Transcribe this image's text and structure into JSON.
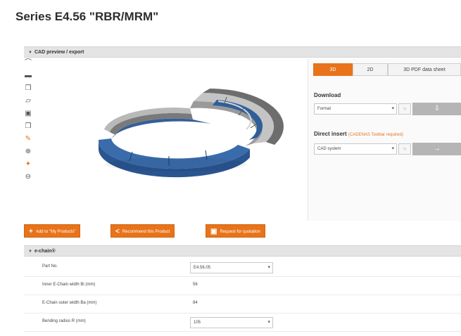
{
  "page_title": "Series E4.56 \"RBR/MRM\"",
  "cad_section": {
    "label": "CAD preview / export",
    "tools": [
      {
        "icon": "view-front-icon",
        "glyph": "⌒"
      },
      {
        "icon": "view-top-icon",
        "glyph": "▬"
      },
      {
        "icon": "view-side-icon",
        "glyph": "❒"
      },
      {
        "icon": "view-iso-icon",
        "glyph": "▱"
      },
      {
        "icon": "view-bottom-icon",
        "glyph": "▣"
      },
      {
        "icon": "view-rear-icon",
        "glyph": "❐"
      },
      {
        "icon": "pan-icon",
        "glyph": "✎"
      },
      {
        "icon": "rotate-icon",
        "glyph": "⊕"
      },
      {
        "icon": "move-icon",
        "glyph": "✦"
      },
      {
        "icon": "measure-icon",
        "glyph": "⊖"
      }
    ],
    "tabs": [
      {
        "label": "3D",
        "active": true
      },
      {
        "label": "2D",
        "active": false
      },
      {
        "label": "3D PDF data sheet",
        "active": false
      }
    ],
    "download": {
      "label": "Download",
      "select_value": "Format"
    },
    "direct_insert": {
      "label": "Direct insert",
      "note": "(CADENAS Toolbar required)",
      "select_value": "CAD system"
    }
  },
  "actions": {
    "add_label": "Add to \"My Products\"",
    "recommend_label": "Recommend this Product",
    "request_label": "Request for quotation"
  },
  "echain_section": {
    "label": "e-chain®",
    "rows": [
      {
        "label": "Part No.",
        "value": "E4.56.05",
        "type": "select"
      },
      {
        "label": "Inner E-Chain width Bi (mm)",
        "value": "56",
        "type": "text"
      },
      {
        "label": "E-Chain outer width Ba (mm)",
        "value": "84",
        "type": "text"
      },
      {
        "label": "Bending radius R (mm)",
        "value": "105",
        "type": "select"
      }
    ]
  },
  "colors": {
    "accent": "#e8731a",
    "part_blue": "#2f5f9a",
    "part_grey": "#8d8d8d"
  }
}
